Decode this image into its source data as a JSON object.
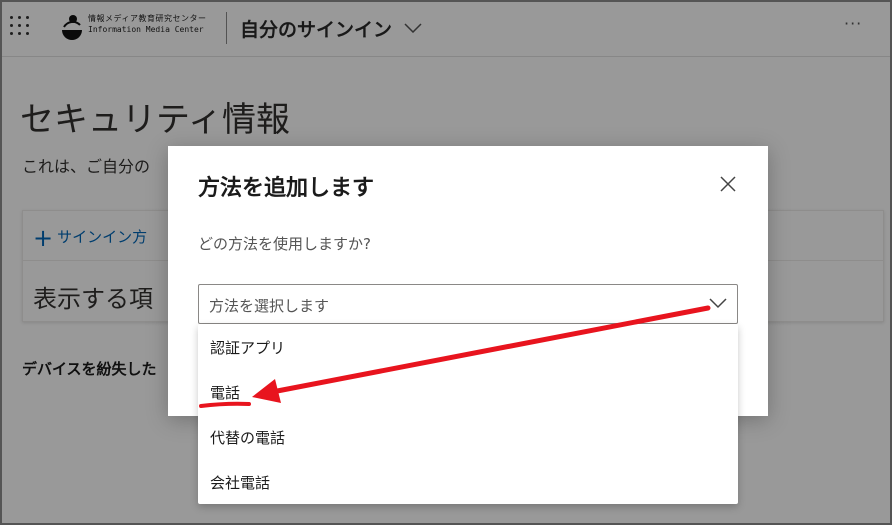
{
  "topbar": {
    "org_name_jp": "情報メディア教育研究センター",
    "org_name_en": "Information Media Center",
    "app_title": "自分のサインイン",
    "more_label": "···"
  },
  "page": {
    "title": "セキュリティ情報",
    "description": "これは、ご自分の",
    "add_method_label": "サインイン方",
    "show_items_label": "表示する項",
    "lost_device_label": "デバイスを紛失した"
  },
  "dialog": {
    "title": "方法を追加します",
    "question": "どの方法を使用しますか?",
    "select_placeholder": "方法を選択します",
    "options": [
      {
        "label": "認証アプリ"
      },
      {
        "label": "電話"
      },
      {
        "label": "代替の電話"
      },
      {
        "label": "会社電話"
      }
    ]
  },
  "colors": {
    "accent": "#0067b8",
    "annotation": "#e8141e",
    "overlay": "rgba(0,0,0,0.40)"
  },
  "icons": [
    "waffle-icon",
    "logo-icon",
    "chevron-down-icon",
    "more-icon",
    "plus-icon",
    "close-icon"
  ]
}
